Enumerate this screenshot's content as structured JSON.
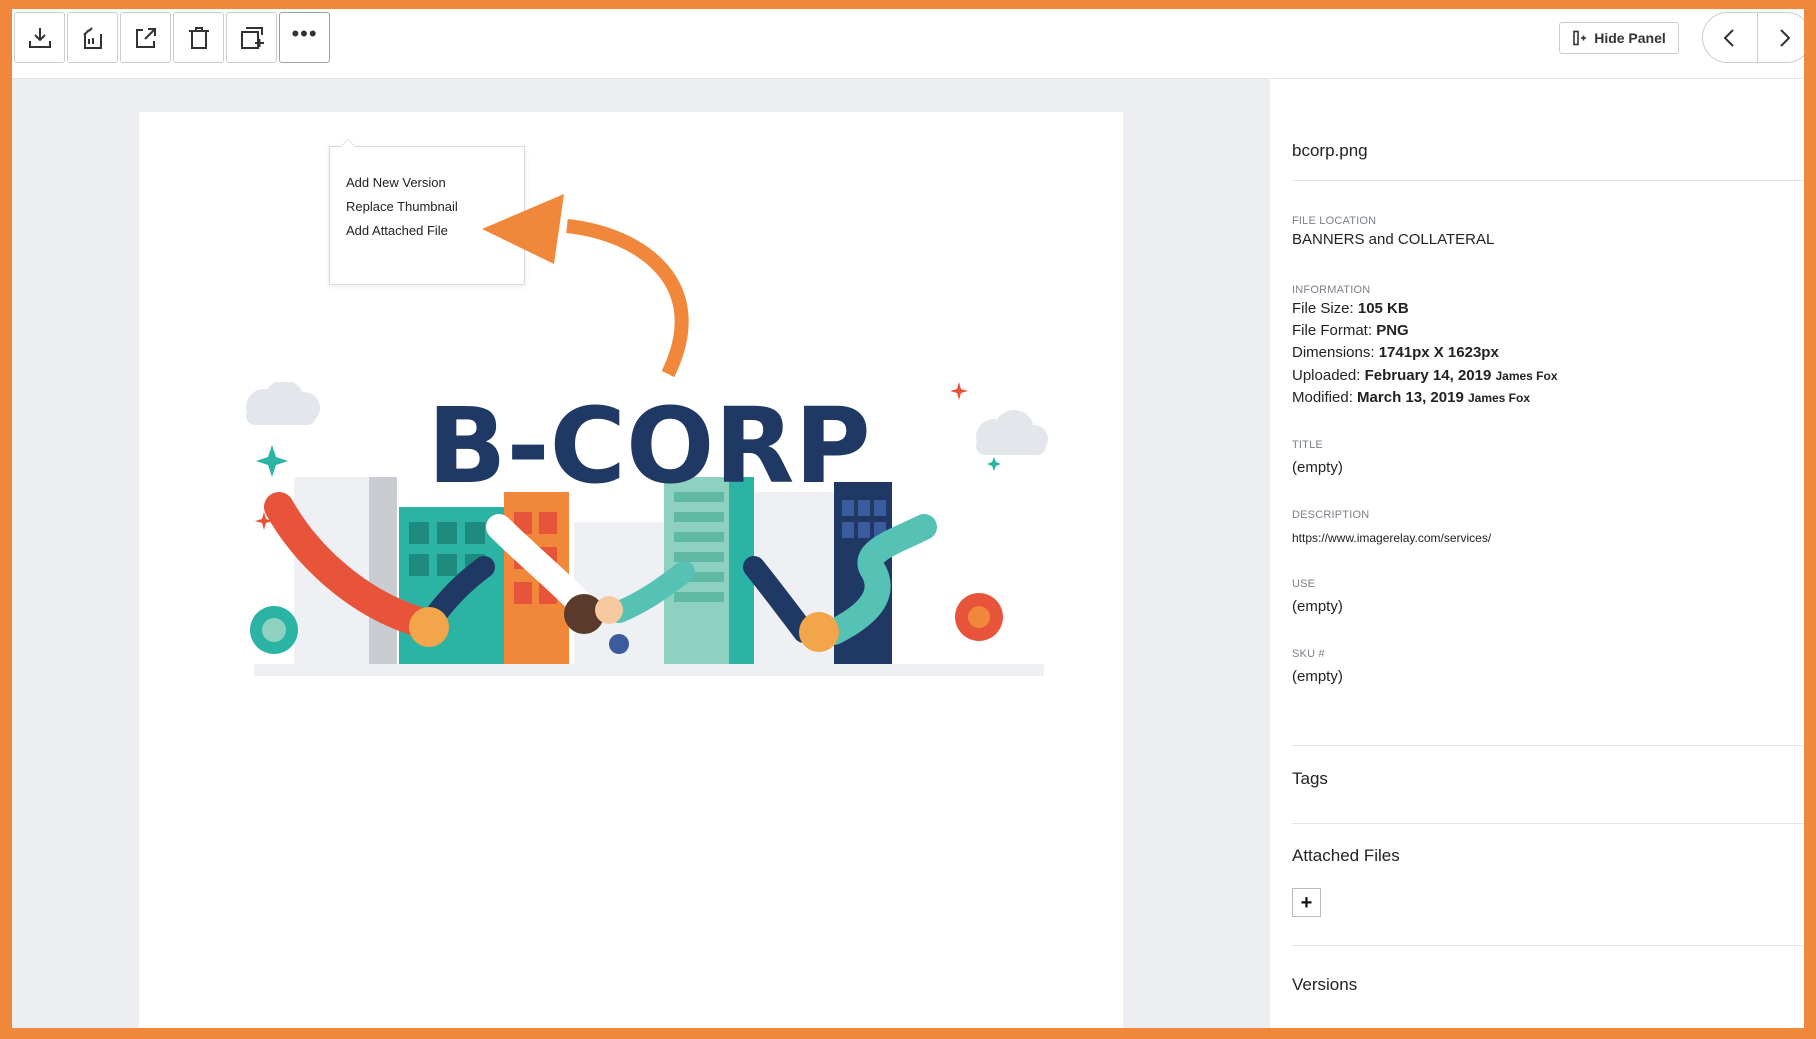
{
  "toolbar": {
    "buttons": [
      {
        "name": "download",
        "icon": "download-icon"
      },
      {
        "name": "share-link",
        "icon": "share-link-icon"
      },
      {
        "name": "export",
        "icon": "export-icon"
      },
      {
        "name": "delete",
        "icon": "trash-icon"
      },
      {
        "name": "add-to-folder",
        "icon": "copy-add-icon"
      },
      {
        "name": "more",
        "icon": "more-icon"
      }
    ],
    "hide_panel_label": "Hide Panel"
  },
  "more_menu": {
    "items": [
      "Add New Version",
      "Replace Thumbnail",
      "Add Attached File"
    ]
  },
  "preview": {
    "logo_text": "B-CORP"
  },
  "panel": {
    "file_name": "bcorp.png",
    "file_location": {
      "label": "FILE LOCATION",
      "value": "BANNERS and COLLATERAL"
    },
    "information": {
      "label": "INFORMATION",
      "file_size_label": "File Size:",
      "file_size": "105 KB",
      "file_format_label": "File Format:",
      "file_format": "PNG",
      "dimensions_label": "Dimensions:",
      "dimensions": "1741px X 1623px",
      "uploaded_label": "Uploaded:",
      "uploaded_date": "February 14, 2019",
      "uploaded_by": "James Fox",
      "modified_label": "Modified:",
      "modified_date": "March 13, 2019",
      "modified_by": "James Fox"
    },
    "title": {
      "label": "TITLE",
      "value": "(empty)"
    },
    "description": {
      "label": "DESCRIPTION",
      "value": "https://www.imagerelay.com/services/"
    },
    "use": {
      "label": "USE",
      "value": "(empty)"
    },
    "sku": {
      "label": "SKU #",
      "value": "(empty)"
    },
    "tags_heading": "Tags",
    "attached_files_heading": "Attached Files",
    "add_button_label": "+",
    "versions_heading": "Versions"
  },
  "colors": {
    "frame_border": "#f0873a",
    "annotation_arrow": "#f0873a",
    "viewer_bg": "#eceef1",
    "logo_navy": "#1f3864"
  }
}
